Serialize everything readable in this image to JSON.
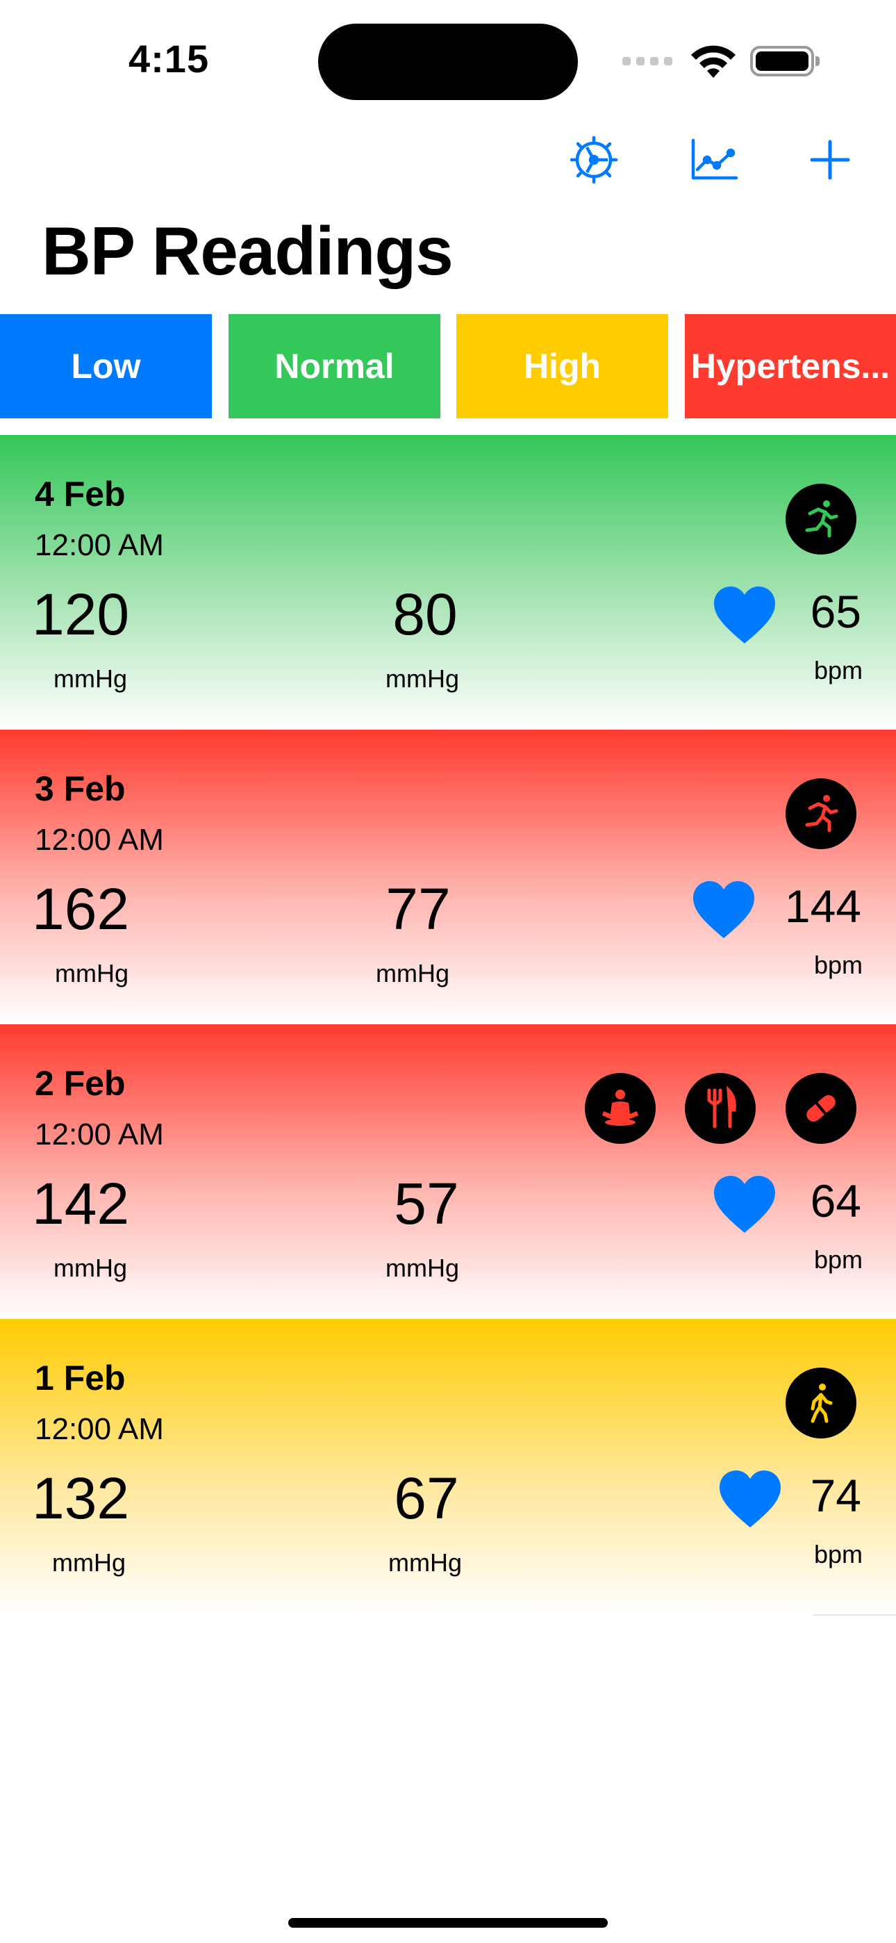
{
  "status_bar": {
    "time": "4:15"
  },
  "toolbar": {
    "icons": [
      "settings-gear-icon",
      "chart-icon",
      "plus-icon"
    ],
    "accent": "#007aff"
  },
  "title": "BP Readings",
  "filters": [
    {
      "label": "Low",
      "color": "#007aff"
    },
    {
      "label": "Normal",
      "color": "#34c759"
    },
    {
      "label": "High",
      "color": "#ffcc00"
    },
    {
      "label": "Hypertens...",
      "color": "#ff3b30"
    }
  ],
  "readings": [
    {
      "date": "4 Feb",
      "time": "12:00 AM",
      "systolic": "120",
      "diastolic": "80",
      "unit": "mmHg",
      "pulse": "65",
      "pulse_unit": "bpm",
      "category_color": "#34c759",
      "tags": [
        "running-icon"
      ]
    },
    {
      "date": "3 Feb",
      "time": "12:00 AM",
      "systolic": "162",
      "diastolic": "77",
      "unit": "mmHg",
      "pulse": "144",
      "pulse_unit": "bpm",
      "category_color": "#ff3b30",
      "tags": [
        "running-icon"
      ]
    },
    {
      "date": "2 Feb",
      "time": "12:00 AM",
      "systolic": "142",
      "diastolic": "57",
      "unit": "mmHg",
      "pulse": "64",
      "pulse_unit": "bpm",
      "category_color": "#ff3b30",
      "tags": [
        "meditation-icon",
        "fork-knife-icon",
        "pill-icon"
      ]
    },
    {
      "date": "1 Feb",
      "time": "12:00 AM",
      "systolic": "132",
      "diastolic": "67",
      "unit": "mmHg",
      "pulse": "74",
      "pulse_unit": "bpm",
      "category_color": "#ffcc00",
      "tags": [
        "walking-icon"
      ]
    }
  ]
}
